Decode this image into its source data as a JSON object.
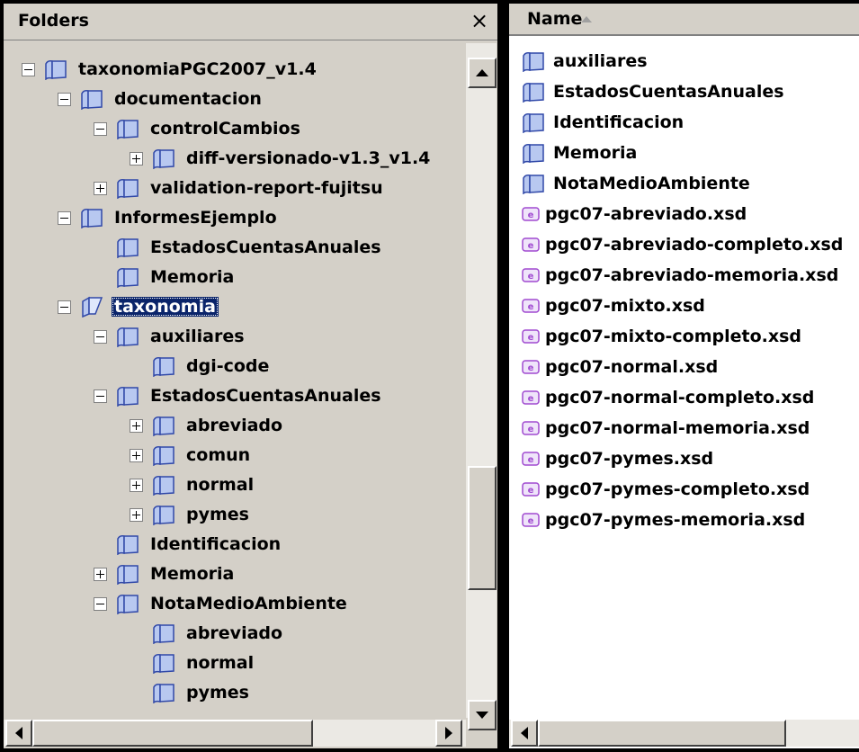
{
  "folders_pane": {
    "title": "Folders",
    "close_label": "×",
    "tree": [
      {
        "label": "taxonomiaPGC2007_v1.4",
        "depth": 0,
        "expander": "minus"
      },
      {
        "label": "documentacion",
        "depth": 1,
        "expander": "minus"
      },
      {
        "label": "controlCambios",
        "depth": 2,
        "expander": "minus"
      },
      {
        "label": "diff-versionado-v1.3_v1.4",
        "depth": 3,
        "expander": "plus"
      },
      {
        "label": "validation-report-fujitsu",
        "depth": 2,
        "expander": "plus"
      },
      {
        "label": "InformesEjemplo",
        "depth": 1,
        "expander": "minus"
      },
      {
        "label": "EstadosCuentasAnuales",
        "depth": 2,
        "expander": "none"
      },
      {
        "label": "Memoria",
        "depth": 2,
        "expander": "none"
      },
      {
        "label": "taxonomia",
        "depth": 1,
        "expander": "minus",
        "selected": true,
        "open": true
      },
      {
        "label": "auxiliares",
        "depth": 2,
        "expander": "minus"
      },
      {
        "label": "dgi-code",
        "depth": 3,
        "expander": "none"
      },
      {
        "label": "EstadosCuentasAnuales",
        "depth": 2,
        "expander": "minus"
      },
      {
        "label": "abreviado",
        "depth": 3,
        "expander": "plus"
      },
      {
        "label": "comun",
        "depth": 3,
        "expander": "plus"
      },
      {
        "label": "normal",
        "depth": 3,
        "expander": "plus"
      },
      {
        "label": "pymes",
        "depth": 3,
        "expander": "plus"
      },
      {
        "label": "Identificacion",
        "depth": 2,
        "expander": "none"
      },
      {
        "label": "Memoria",
        "depth": 2,
        "expander": "plus"
      },
      {
        "label": "NotaMedioAmbiente",
        "depth": 2,
        "expander": "minus"
      },
      {
        "label": "abreviado",
        "depth": 3,
        "expander": "none"
      },
      {
        "label": "normal",
        "depth": 3,
        "expander": "none"
      },
      {
        "label": "pymes",
        "depth": 3,
        "expander": "none"
      }
    ]
  },
  "files_pane": {
    "column_name": "Name",
    "sort": "ascending",
    "items": [
      {
        "name": "auxiliares",
        "type": "folder"
      },
      {
        "name": "EstadosCuentasAnuales",
        "type": "folder"
      },
      {
        "name": "Identificacion",
        "type": "folder"
      },
      {
        "name": "Memoria",
        "type": "folder"
      },
      {
        "name": "NotaMedioAmbiente",
        "type": "folder"
      },
      {
        "name": "pgc07-abreviado.xsd",
        "type": "xsd"
      },
      {
        "name": "pgc07-abreviado-completo.xsd",
        "type": "xsd"
      },
      {
        "name": "pgc07-abreviado-memoria.xsd",
        "type": "xsd"
      },
      {
        "name": "pgc07-mixto.xsd",
        "type": "xsd"
      },
      {
        "name": "pgc07-mixto-completo.xsd",
        "type": "xsd"
      },
      {
        "name": "pgc07-normal.xsd",
        "type": "xsd"
      },
      {
        "name": "pgc07-normal-completo.xsd",
        "type": "xsd"
      },
      {
        "name": "pgc07-normal-memoria.xsd",
        "type": "xsd"
      },
      {
        "name": "pgc07-pymes.xsd",
        "type": "xsd"
      },
      {
        "name": "pgc07-pymes-completo.xsd",
        "type": "xsd"
      },
      {
        "name": "pgc07-pymes-memoria.xsd",
        "type": "xsd"
      }
    ]
  },
  "colors": {
    "folder_fill": "#b8c8f0",
    "folder_stroke": "#3048a8",
    "selection": "#0a246a",
    "xsd_icon": "#a04ad0"
  }
}
